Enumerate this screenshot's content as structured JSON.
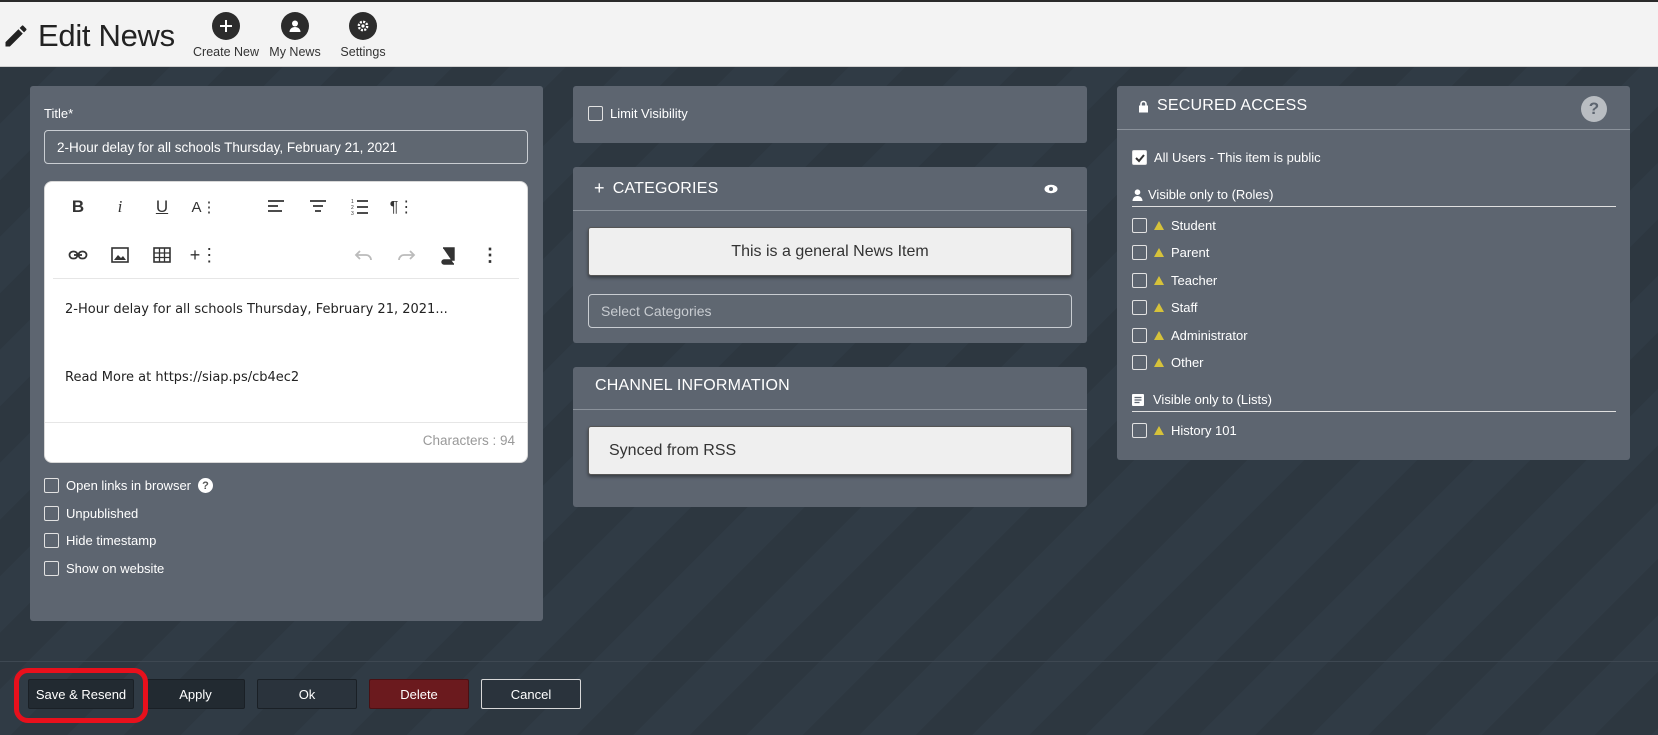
{
  "header": {
    "title": "Edit News",
    "buttons": [
      {
        "label": "Create New",
        "icon": "plus-icon"
      },
      {
        "label": "My News",
        "icon": "user-icon"
      },
      {
        "label": "Settings",
        "icon": "gear-icon"
      }
    ]
  },
  "left_panel": {
    "title_label": "Title*",
    "title_value": "2-Hour delay for all schools Thursday, February 21, 2021",
    "editor": {
      "toolbar_row1": [
        "bold",
        "italic",
        "underline",
        "font-size",
        "align-left",
        "align-center",
        "ordered-list",
        "paragraph"
      ],
      "toolbar_row2": [
        "link",
        "image",
        "table",
        "insert",
        "undo",
        "redo",
        "book",
        "more"
      ],
      "line1": "2-Hour delay for all schools Thursday, February 21, 2021...",
      "line2": "Read More at https://siap.ps/cb4ec2",
      "char_count": "Characters : 94"
    },
    "options": [
      {
        "label": "Open links in browser",
        "checked": false,
        "help": true
      },
      {
        "label": "Unpublished",
        "checked": false
      },
      {
        "label": "Hide timestamp",
        "checked": false
      },
      {
        "label": "Show on website",
        "checked": false
      }
    ]
  },
  "middle_panel": {
    "limit_visibility": "Limit Visibility",
    "categories_title": "CATEGORIES",
    "categories_plus": "+",
    "general_item": "This is a general News Item",
    "select_placeholder": "Select Categories",
    "channel_title": "CHANNEL INFORMATION",
    "channel_value": "Synced from RSS"
  },
  "right_panel": {
    "title": "SECURED ACCESS",
    "help": "?",
    "all_users": "All Users - This item is public",
    "all_users_checked": true,
    "roles_title": "Visible only to (Roles)",
    "roles": [
      "Student",
      "Parent",
      "Teacher",
      "Staff",
      "Administrator",
      "Other"
    ],
    "lists_title": "Visible only to (Lists)",
    "lists": [
      "History 101"
    ]
  },
  "footer": {
    "save_resend": "Save & Resend",
    "apply": "Apply",
    "ok": "Ok",
    "delete": "Delete",
    "cancel": "Cancel"
  },
  "colors": {
    "highlight": "#e8101c",
    "delete_bg": "#6b1a1e",
    "warning": "#d6c23a"
  }
}
